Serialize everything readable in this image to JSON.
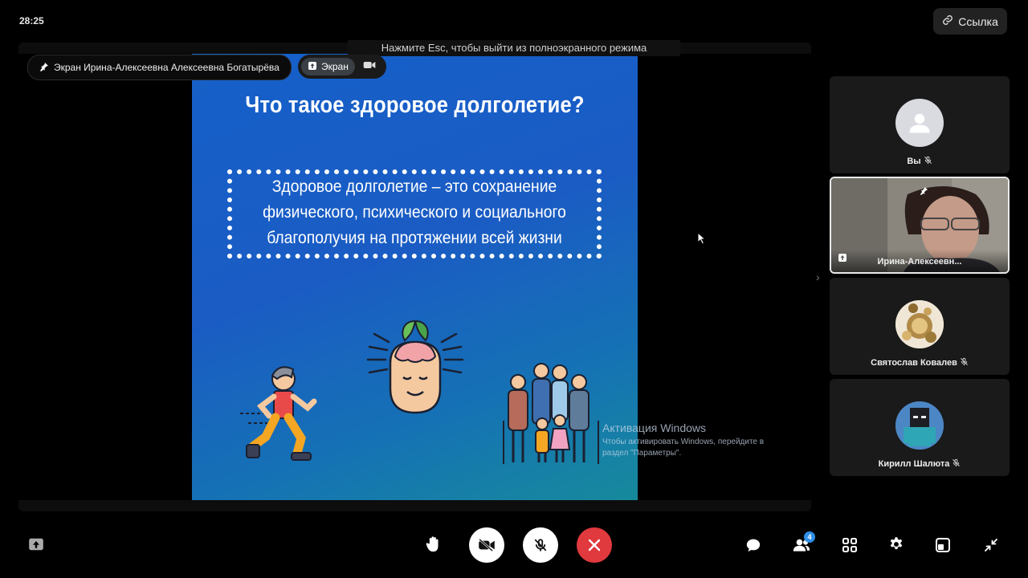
{
  "timer": "28:25",
  "link_button": {
    "label": "Ссылка"
  },
  "fullscreen_hint": "Нажмите Esc, чтобы выйти из полноэкранного режима",
  "pinned_screen": {
    "label": "Экран Ирина-Алексеевна Алексеевна Богатырёва"
  },
  "screen_pill": {
    "label": "Экран"
  },
  "slide": {
    "title": "Что такое здоровое долголетие?",
    "definition_lines": [
      "Здоровое долголетие – это сохранение",
      "физического, психического и социального",
      "благополучия на протяжении всей жизни"
    ]
  },
  "windows_activation": {
    "title": "Активация Windows",
    "line1": "Чтобы активировать Windows, перейдите в",
    "line2": "раздел \"Параметры\"."
  },
  "participants": [
    {
      "name": "Вы",
      "muted": true
    },
    {
      "name": "Ирина-Алексеевн...",
      "pinned": true,
      "screen_sharing": true
    },
    {
      "name": "Святослав Ковалев",
      "muted": true
    },
    {
      "name": "Кирилл Шалюта",
      "muted": true
    }
  ],
  "toolbar": {
    "participants_count": "4"
  },
  "colors": {
    "end_call": "#e0393e",
    "badge": "#2d8fe8",
    "slide_top": "#1560c9",
    "slide_bottom": "#168a9c"
  }
}
